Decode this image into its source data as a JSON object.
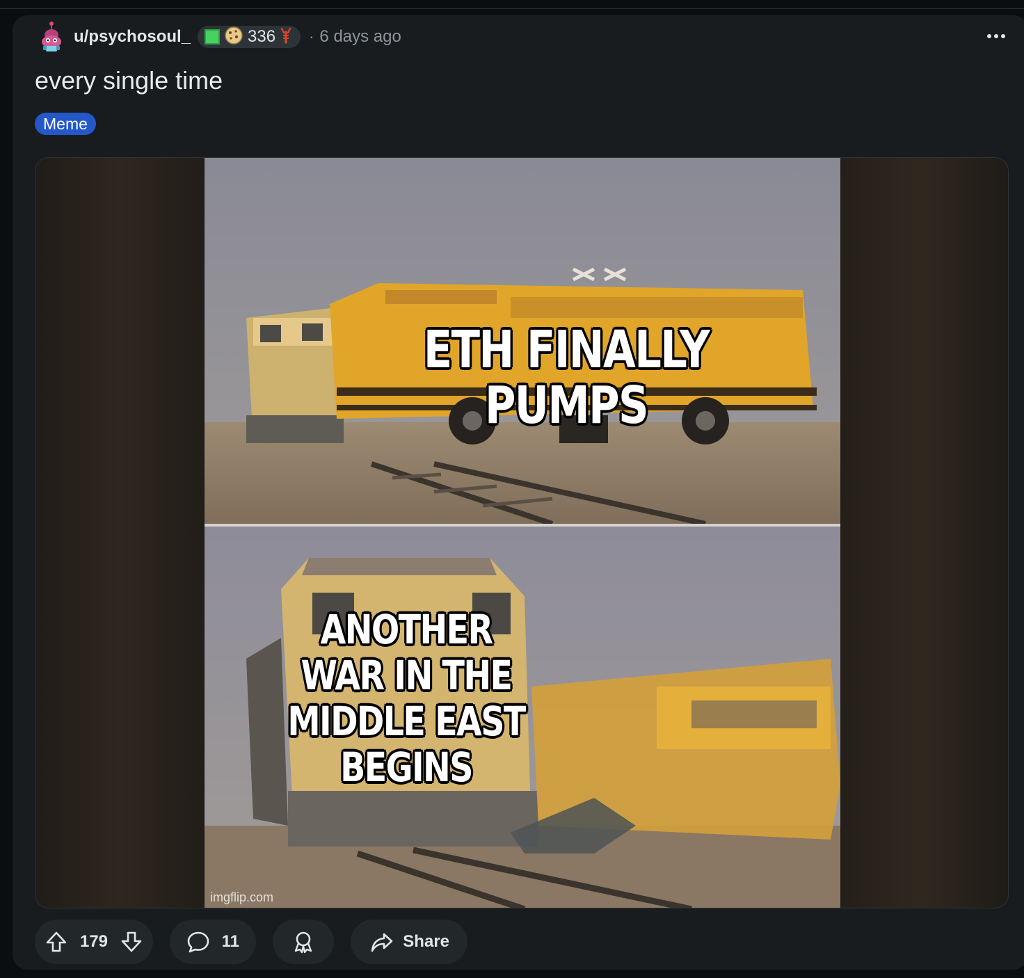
{
  "post": {
    "author": "u/psychosoul_",
    "flair_count": "336",
    "separator": "·",
    "time_ago": "6 days ago",
    "title": "every single time",
    "tag": "Meme"
  },
  "meme": {
    "top_caption": "ETH FINALLY PUMPS",
    "bottom_caption": "ANOTHER WAR IN THE MIDDLE EAST BEGINS",
    "watermark": "imgflip.com"
  },
  "actions": {
    "upvotes": "179",
    "comments": "11",
    "share_label": "Share"
  },
  "icons": {
    "more": "more-options-icon",
    "upvote": "upvote-arrow-icon",
    "downvote": "downvote-arrow-icon",
    "comment": "comment-bubble-icon",
    "award": "award-icon",
    "share": "share-arrow-icon"
  },
  "colors": {
    "card_bg": "#181c1f",
    "tag_bg": "#2458c9",
    "page_bg": "#0b0e10"
  }
}
